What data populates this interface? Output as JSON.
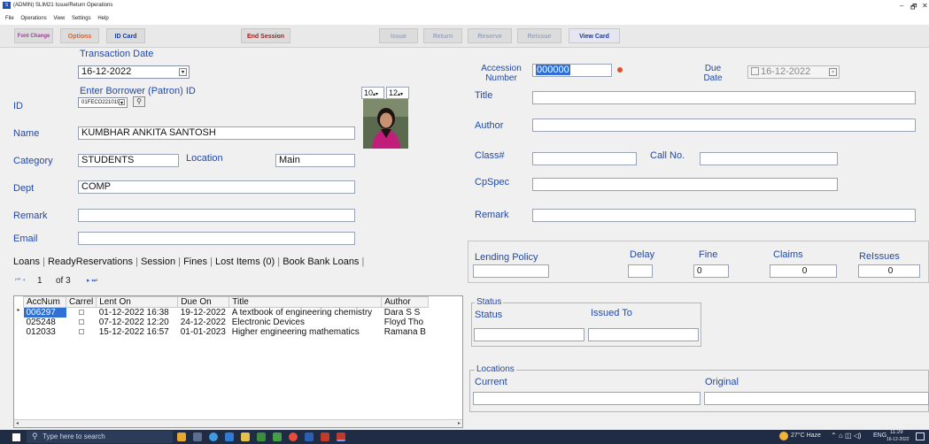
{
  "window": {
    "title": "(ADMIN) SLIM21 Issue/Return Operations",
    "app_icon": "slim",
    "minimize": "–",
    "restore": "🗗",
    "close": "✕"
  },
  "menu": [
    "File",
    "Operations",
    "View",
    "Settings",
    "Help"
  ],
  "toolbar": {
    "font_change": "Font Change",
    "options": "Options",
    "id_card": "ID Card",
    "end_session": "End Session",
    "issue": "Issue",
    "return": "Return",
    "reserve": "Reserve",
    "reissue": "Reissue",
    "view_card": "View Card"
  },
  "left": {
    "transaction_date_label": "Transaction Date",
    "transaction_date": "16-12-2022",
    "borrower_label": "Enter Borrower (Patron) ID",
    "id_label": "ID",
    "id_value": "01FECO221019",
    "spin1": "10",
    "spin2": "12",
    "name_label": "Name",
    "name_value": "KUMBHAR ANKITA SANTOSH",
    "category_label": "Category",
    "category_value": "STUDENTS",
    "location_label": "Location",
    "location_value": "Main",
    "dept_label": "Dept",
    "dept_value": "COMP",
    "remark_label": "Remark",
    "remark_value": "",
    "email_label": "Email",
    "email_value": ""
  },
  "tabs": [
    "Loans",
    "ReadyReservations",
    "Session",
    "Fines",
    "Lost Items (0)",
    "Book Bank Loans"
  ],
  "pager": {
    "current": "1",
    "of": "of 3"
  },
  "loans": {
    "headers": [
      "AccNum",
      "Carrel",
      "Lent On",
      "Due On",
      "Title",
      "Author"
    ],
    "rows": [
      [
        "006297",
        "",
        "01-12-2022 16:38",
        "19-12-2022",
        "A textbook of engineering chemistry",
        "Dara S S"
      ],
      [
        "025248",
        "",
        "07-12-2022 12:20",
        "24-12-2022",
        "Electronic Devices",
        "Floyd Tho"
      ],
      [
        "012033",
        "",
        "15-12-2022 16:57",
        "01-01-2023",
        "Higher engineering mathematics",
        "Ramana B"
      ]
    ]
  },
  "right": {
    "accession_label": "Accession Number",
    "accession_value": "000000",
    "due_label": "Due Date",
    "due_value": "16-12-2022",
    "title_label": "Title",
    "author_label": "Author",
    "class_label": "Class#",
    "callno_label": "Call No.",
    "cpspec_label": "CpSpec",
    "remark_label": "Remark",
    "lending_policy_label": "Lending Policy",
    "delay_label": "Delay",
    "fine_label": "Fine",
    "fine_value": "0",
    "claims_label": "Claims",
    "claims_value": "0",
    "reissues_label": "ReIssues",
    "reissues_value": "0",
    "status_group": "Status",
    "status_label": "Status",
    "issued_to_label": "Issued To",
    "locations_group": "Locations",
    "current_label": "Current",
    "original_label": "Original"
  },
  "taskbar": {
    "search_placeholder": "Type here to search",
    "weather": "27°C Haze",
    "lang": "ENG",
    "time": "11:29",
    "date": "16-12-2022"
  }
}
